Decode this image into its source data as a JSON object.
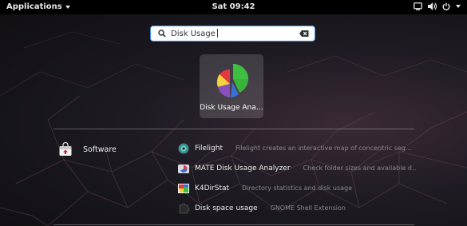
{
  "topbar": {
    "applications_label": "Applications",
    "clock": "Sat 09:42",
    "tray_icons": [
      "screen-icon",
      "volume-icon",
      "power-icon",
      "caret-down-icon"
    ]
  },
  "search": {
    "value": "Disk Usage",
    "icon": "search-icon",
    "clear_icon": "clear-icon"
  },
  "app_tile": {
    "label": "Disk Usage Ana…",
    "icon": "pie-chart-icon"
  },
  "provider": {
    "label": "Software",
    "icon": "software-bag-icon"
  },
  "results": [
    {
      "name": "Filelight",
      "desc": "Filelight creates an interactive map of concentric seg…",
      "icon": "filelight-icon"
    },
    {
      "name": "MATE Disk Usage Analyzer",
      "desc": "Check folder sizes and available d…",
      "icon": "mate-disk-icon"
    },
    {
      "name": "K4DirStat",
      "desc": "Directory statistics and disk usage",
      "icon": "k4dirstat-icon"
    },
    {
      "name": "Disk space usage",
      "desc": "GNOME Shell Extension",
      "icon": "extension-icon"
    }
  ],
  "colors": {
    "focus_ring": "#4a90d9",
    "topbar": "#000000",
    "pie_green": "#3fbf3f",
    "pie_blue": "#3b6fd8",
    "pie_red": "#e0393e",
    "pie_yellow": "#f4d33a",
    "pie_purple": "#8a4fbf"
  }
}
